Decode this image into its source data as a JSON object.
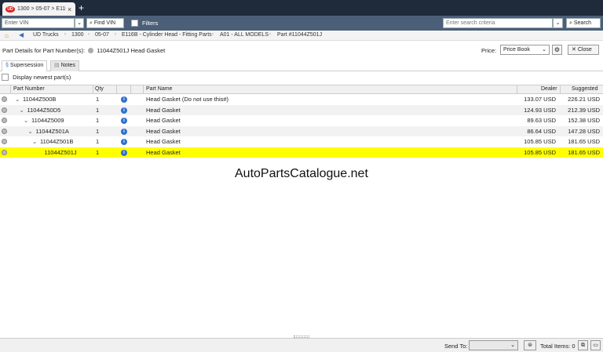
{
  "browser": {
    "tab_title": "1300 > 05-07 > E116B",
    "tab_logo": "UD",
    "tab_close": "×",
    "new_tab": "+"
  },
  "toolbar": {
    "vin_placeholder": "Enter VIN",
    "find_vin_label": "Find VIN",
    "filters_label": "Filters",
    "search_placeholder": "Enter search criteria",
    "search_label": "Search"
  },
  "breadcrumb": [
    "UD Trucks",
    "1300",
    "05-07",
    "E116B - Cylinder Head - Fitting Parts",
    "A01 - ALL MODELS",
    "Part #11044Z501J"
  ],
  "header": {
    "title_prefix": "Part Details for Part Number(s):",
    "title_part": "11044Z501J Head Gasket",
    "price_label": "Price:",
    "price_value": "Price Book",
    "close_label": "Close"
  },
  "subtabs": [
    "Supersession",
    "Notes"
  ],
  "newest_label": "Display newest part(s)",
  "table": {
    "columns": [
      "Part Number",
      "Qty",
      "Part Name",
      "Dealer",
      "Suggested"
    ],
    "rows": [
      {
        "part": "11044Z500B",
        "indent": 0,
        "qty": "1",
        "name": "Head Gasket (Do not use this#)",
        "dealer": "133.07 USD",
        "suggested": "226.21 USD"
      },
      {
        "part": "11044Z50D5",
        "indent": 1,
        "qty": "1",
        "name": "Head Gasket",
        "dealer": "124.93 USD",
        "suggested": "212.39 USD"
      },
      {
        "part": "11044Z5009",
        "indent": 2,
        "qty": "1",
        "name": "Head Gasket",
        "dealer": "89.63 USD",
        "suggested": "152.38 USD"
      },
      {
        "part": "11044Z501A",
        "indent": 3,
        "qty": "1",
        "name": "Head Gasket",
        "dealer": "86.64 USD",
        "suggested": "147.28 USD"
      },
      {
        "part": "11044Z501B",
        "indent": 4,
        "qty": "1",
        "name": "Head Gasket",
        "dealer": "105.85 USD",
        "suggested": "181.65 USD"
      },
      {
        "part": "11044Z501J",
        "indent": 5,
        "qty": "1",
        "name": "Head Gasket",
        "dealer": "105.85 USD",
        "suggested": "181.65 USD",
        "highlight": true
      }
    ]
  },
  "watermark": "AutoPartsCatalogue.net",
  "footer": {
    "send_to_label": "Send To:",
    "total_label": "Total Items: 0"
  },
  "colors": {
    "highlight": "#ffff00",
    "toolbar": "#4c5f78",
    "tabstrip": "#1f2a3a",
    "info_icon": "#2d6fd0"
  }
}
